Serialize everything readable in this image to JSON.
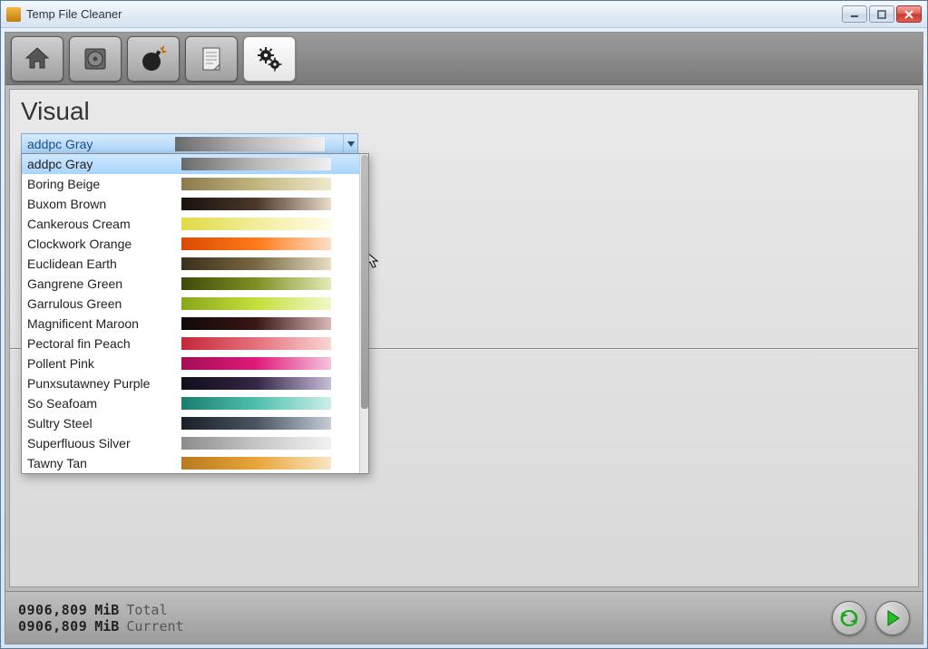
{
  "window": {
    "title": "Temp File Cleaner"
  },
  "toolbar": {
    "buttons": [
      {
        "name": "home",
        "active": false
      },
      {
        "name": "drive",
        "active": false
      },
      {
        "name": "bomb",
        "active": false
      },
      {
        "name": "report",
        "active": false
      },
      {
        "name": "settings",
        "active": true
      }
    ]
  },
  "section": {
    "title": "Visual"
  },
  "combo": {
    "selected_label": "addpc Gray",
    "selected_gradient": [
      "#6a6a6a",
      "#b9b9b9",
      "#f0f0f0"
    ]
  },
  "themes": [
    {
      "label": "addpc Gray",
      "gradient": [
        "#6a6a6a",
        "#b9b9b9",
        "#f0f0f0"
      ],
      "selected": true
    },
    {
      "label": "Boring Beige",
      "gradient": [
        "#8b7a4a",
        "#c2b67f",
        "#efe8cc"
      ]
    },
    {
      "label": "Buxom Brown",
      "gradient": [
        "#1a120c",
        "#4a382a",
        "#eadbca"
      ]
    },
    {
      "label": "Cankerous Cream",
      "gradient": [
        "#e0da46",
        "#f2ed9a",
        "#fefde8"
      ]
    },
    {
      "label": "Clockwork Orange",
      "gradient": [
        "#d94a00",
        "#ff7a1a",
        "#ffe0c7"
      ]
    },
    {
      "label": "Euclidean Earth",
      "gradient": [
        "#3a2e1c",
        "#7a6842",
        "#e7dec4"
      ]
    },
    {
      "label": "Gangrene Green",
      "gradient": [
        "#3f4a0a",
        "#808f24",
        "#e4eab7"
      ]
    },
    {
      "label": "Garrulous Green",
      "gradient": [
        "#89a61a",
        "#c5df3a",
        "#f2f8c9"
      ]
    },
    {
      "label": "Magnificent Maroon",
      "gradient": [
        "#120808",
        "#3a1616",
        "#d9b8b8"
      ]
    },
    {
      "label": "Pectoral fin Peach",
      "gradient": [
        "#c3283a",
        "#e6707c",
        "#f9d6d4"
      ]
    },
    {
      "label": "Pollent Pink",
      "gradient": [
        "#a30d54",
        "#e01a7a",
        "#f5c4de"
      ]
    },
    {
      "label": "Punxsutawney Purple",
      "gradient": [
        "#120d1a",
        "#332646",
        "#c9bcda"
      ]
    },
    {
      "label": "So Seafoam",
      "gradient": [
        "#1a7d6e",
        "#4fc0ad",
        "#ccefe8"
      ]
    },
    {
      "label": "Sultry Steel",
      "gradient": [
        "#1a1f26",
        "#4a5562",
        "#c4ccd6"
      ]
    },
    {
      "label": "Superfluous Silver",
      "gradient": [
        "#8c8c8c",
        "#c6c6c6",
        "#f2f2f2"
      ]
    },
    {
      "label": "Tawny Tan",
      "gradient": [
        "#b87a1f",
        "#e8a538",
        "#f8e6c4"
      ]
    }
  ],
  "status": {
    "total_value": "0906,809",
    "total_unit": "MiB",
    "total_label": "Total",
    "current_value": "0906,809",
    "current_unit": "MiB",
    "current_label": "Current"
  }
}
